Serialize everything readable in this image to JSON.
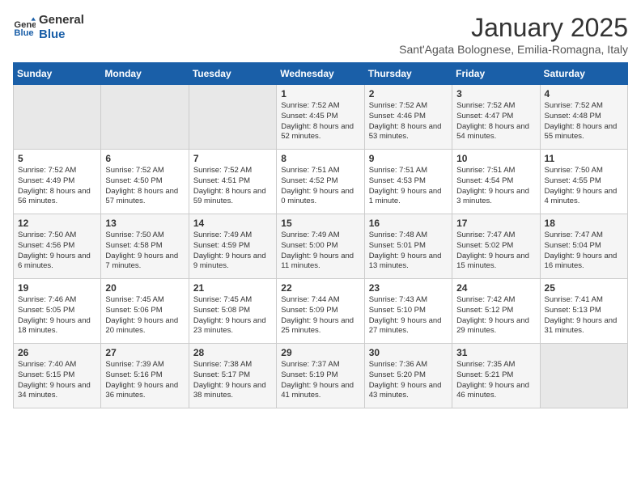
{
  "logo": {
    "line1": "General",
    "line2": "Blue"
  },
  "title": "January 2025",
  "location": "Sant'Agata Bolognese, Emilia-Romagna, Italy",
  "days_of_week": [
    "Sunday",
    "Monday",
    "Tuesday",
    "Wednesday",
    "Thursday",
    "Friday",
    "Saturday"
  ],
  "weeks": [
    [
      {
        "day": "",
        "info": ""
      },
      {
        "day": "",
        "info": ""
      },
      {
        "day": "",
        "info": ""
      },
      {
        "day": "1",
        "info": "Sunrise: 7:52 AM\nSunset: 4:45 PM\nDaylight: 8 hours and 52 minutes."
      },
      {
        "day": "2",
        "info": "Sunrise: 7:52 AM\nSunset: 4:46 PM\nDaylight: 8 hours and 53 minutes."
      },
      {
        "day": "3",
        "info": "Sunrise: 7:52 AM\nSunset: 4:47 PM\nDaylight: 8 hours and 54 minutes."
      },
      {
        "day": "4",
        "info": "Sunrise: 7:52 AM\nSunset: 4:48 PM\nDaylight: 8 hours and 55 minutes."
      }
    ],
    [
      {
        "day": "5",
        "info": "Sunrise: 7:52 AM\nSunset: 4:49 PM\nDaylight: 8 hours and 56 minutes."
      },
      {
        "day": "6",
        "info": "Sunrise: 7:52 AM\nSunset: 4:50 PM\nDaylight: 8 hours and 57 minutes."
      },
      {
        "day": "7",
        "info": "Sunrise: 7:52 AM\nSunset: 4:51 PM\nDaylight: 8 hours and 59 minutes."
      },
      {
        "day": "8",
        "info": "Sunrise: 7:51 AM\nSunset: 4:52 PM\nDaylight: 9 hours and 0 minutes."
      },
      {
        "day": "9",
        "info": "Sunrise: 7:51 AM\nSunset: 4:53 PM\nDaylight: 9 hours and 1 minute."
      },
      {
        "day": "10",
        "info": "Sunrise: 7:51 AM\nSunset: 4:54 PM\nDaylight: 9 hours and 3 minutes."
      },
      {
        "day": "11",
        "info": "Sunrise: 7:50 AM\nSunset: 4:55 PM\nDaylight: 9 hours and 4 minutes."
      }
    ],
    [
      {
        "day": "12",
        "info": "Sunrise: 7:50 AM\nSunset: 4:56 PM\nDaylight: 9 hours and 6 minutes."
      },
      {
        "day": "13",
        "info": "Sunrise: 7:50 AM\nSunset: 4:58 PM\nDaylight: 9 hours and 7 minutes."
      },
      {
        "day": "14",
        "info": "Sunrise: 7:49 AM\nSunset: 4:59 PM\nDaylight: 9 hours and 9 minutes."
      },
      {
        "day": "15",
        "info": "Sunrise: 7:49 AM\nSunset: 5:00 PM\nDaylight: 9 hours and 11 minutes."
      },
      {
        "day": "16",
        "info": "Sunrise: 7:48 AM\nSunset: 5:01 PM\nDaylight: 9 hours and 13 minutes."
      },
      {
        "day": "17",
        "info": "Sunrise: 7:47 AM\nSunset: 5:02 PM\nDaylight: 9 hours and 15 minutes."
      },
      {
        "day": "18",
        "info": "Sunrise: 7:47 AM\nSunset: 5:04 PM\nDaylight: 9 hours and 16 minutes."
      }
    ],
    [
      {
        "day": "19",
        "info": "Sunrise: 7:46 AM\nSunset: 5:05 PM\nDaylight: 9 hours and 18 minutes."
      },
      {
        "day": "20",
        "info": "Sunrise: 7:45 AM\nSunset: 5:06 PM\nDaylight: 9 hours and 20 minutes."
      },
      {
        "day": "21",
        "info": "Sunrise: 7:45 AM\nSunset: 5:08 PM\nDaylight: 9 hours and 23 minutes."
      },
      {
        "day": "22",
        "info": "Sunrise: 7:44 AM\nSunset: 5:09 PM\nDaylight: 9 hours and 25 minutes."
      },
      {
        "day": "23",
        "info": "Sunrise: 7:43 AM\nSunset: 5:10 PM\nDaylight: 9 hours and 27 minutes."
      },
      {
        "day": "24",
        "info": "Sunrise: 7:42 AM\nSunset: 5:12 PM\nDaylight: 9 hours and 29 minutes."
      },
      {
        "day": "25",
        "info": "Sunrise: 7:41 AM\nSunset: 5:13 PM\nDaylight: 9 hours and 31 minutes."
      }
    ],
    [
      {
        "day": "26",
        "info": "Sunrise: 7:40 AM\nSunset: 5:15 PM\nDaylight: 9 hours and 34 minutes."
      },
      {
        "day": "27",
        "info": "Sunrise: 7:39 AM\nSunset: 5:16 PM\nDaylight: 9 hours and 36 minutes."
      },
      {
        "day": "28",
        "info": "Sunrise: 7:38 AM\nSunset: 5:17 PM\nDaylight: 9 hours and 38 minutes."
      },
      {
        "day": "29",
        "info": "Sunrise: 7:37 AM\nSunset: 5:19 PM\nDaylight: 9 hours and 41 minutes."
      },
      {
        "day": "30",
        "info": "Sunrise: 7:36 AM\nSunset: 5:20 PM\nDaylight: 9 hours and 43 minutes."
      },
      {
        "day": "31",
        "info": "Sunrise: 7:35 AM\nSunset: 5:21 PM\nDaylight: 9 hours and 46 minutes."
      },
      {
        "day": "",
        "info": ""
      }
    ]
  ]
}
